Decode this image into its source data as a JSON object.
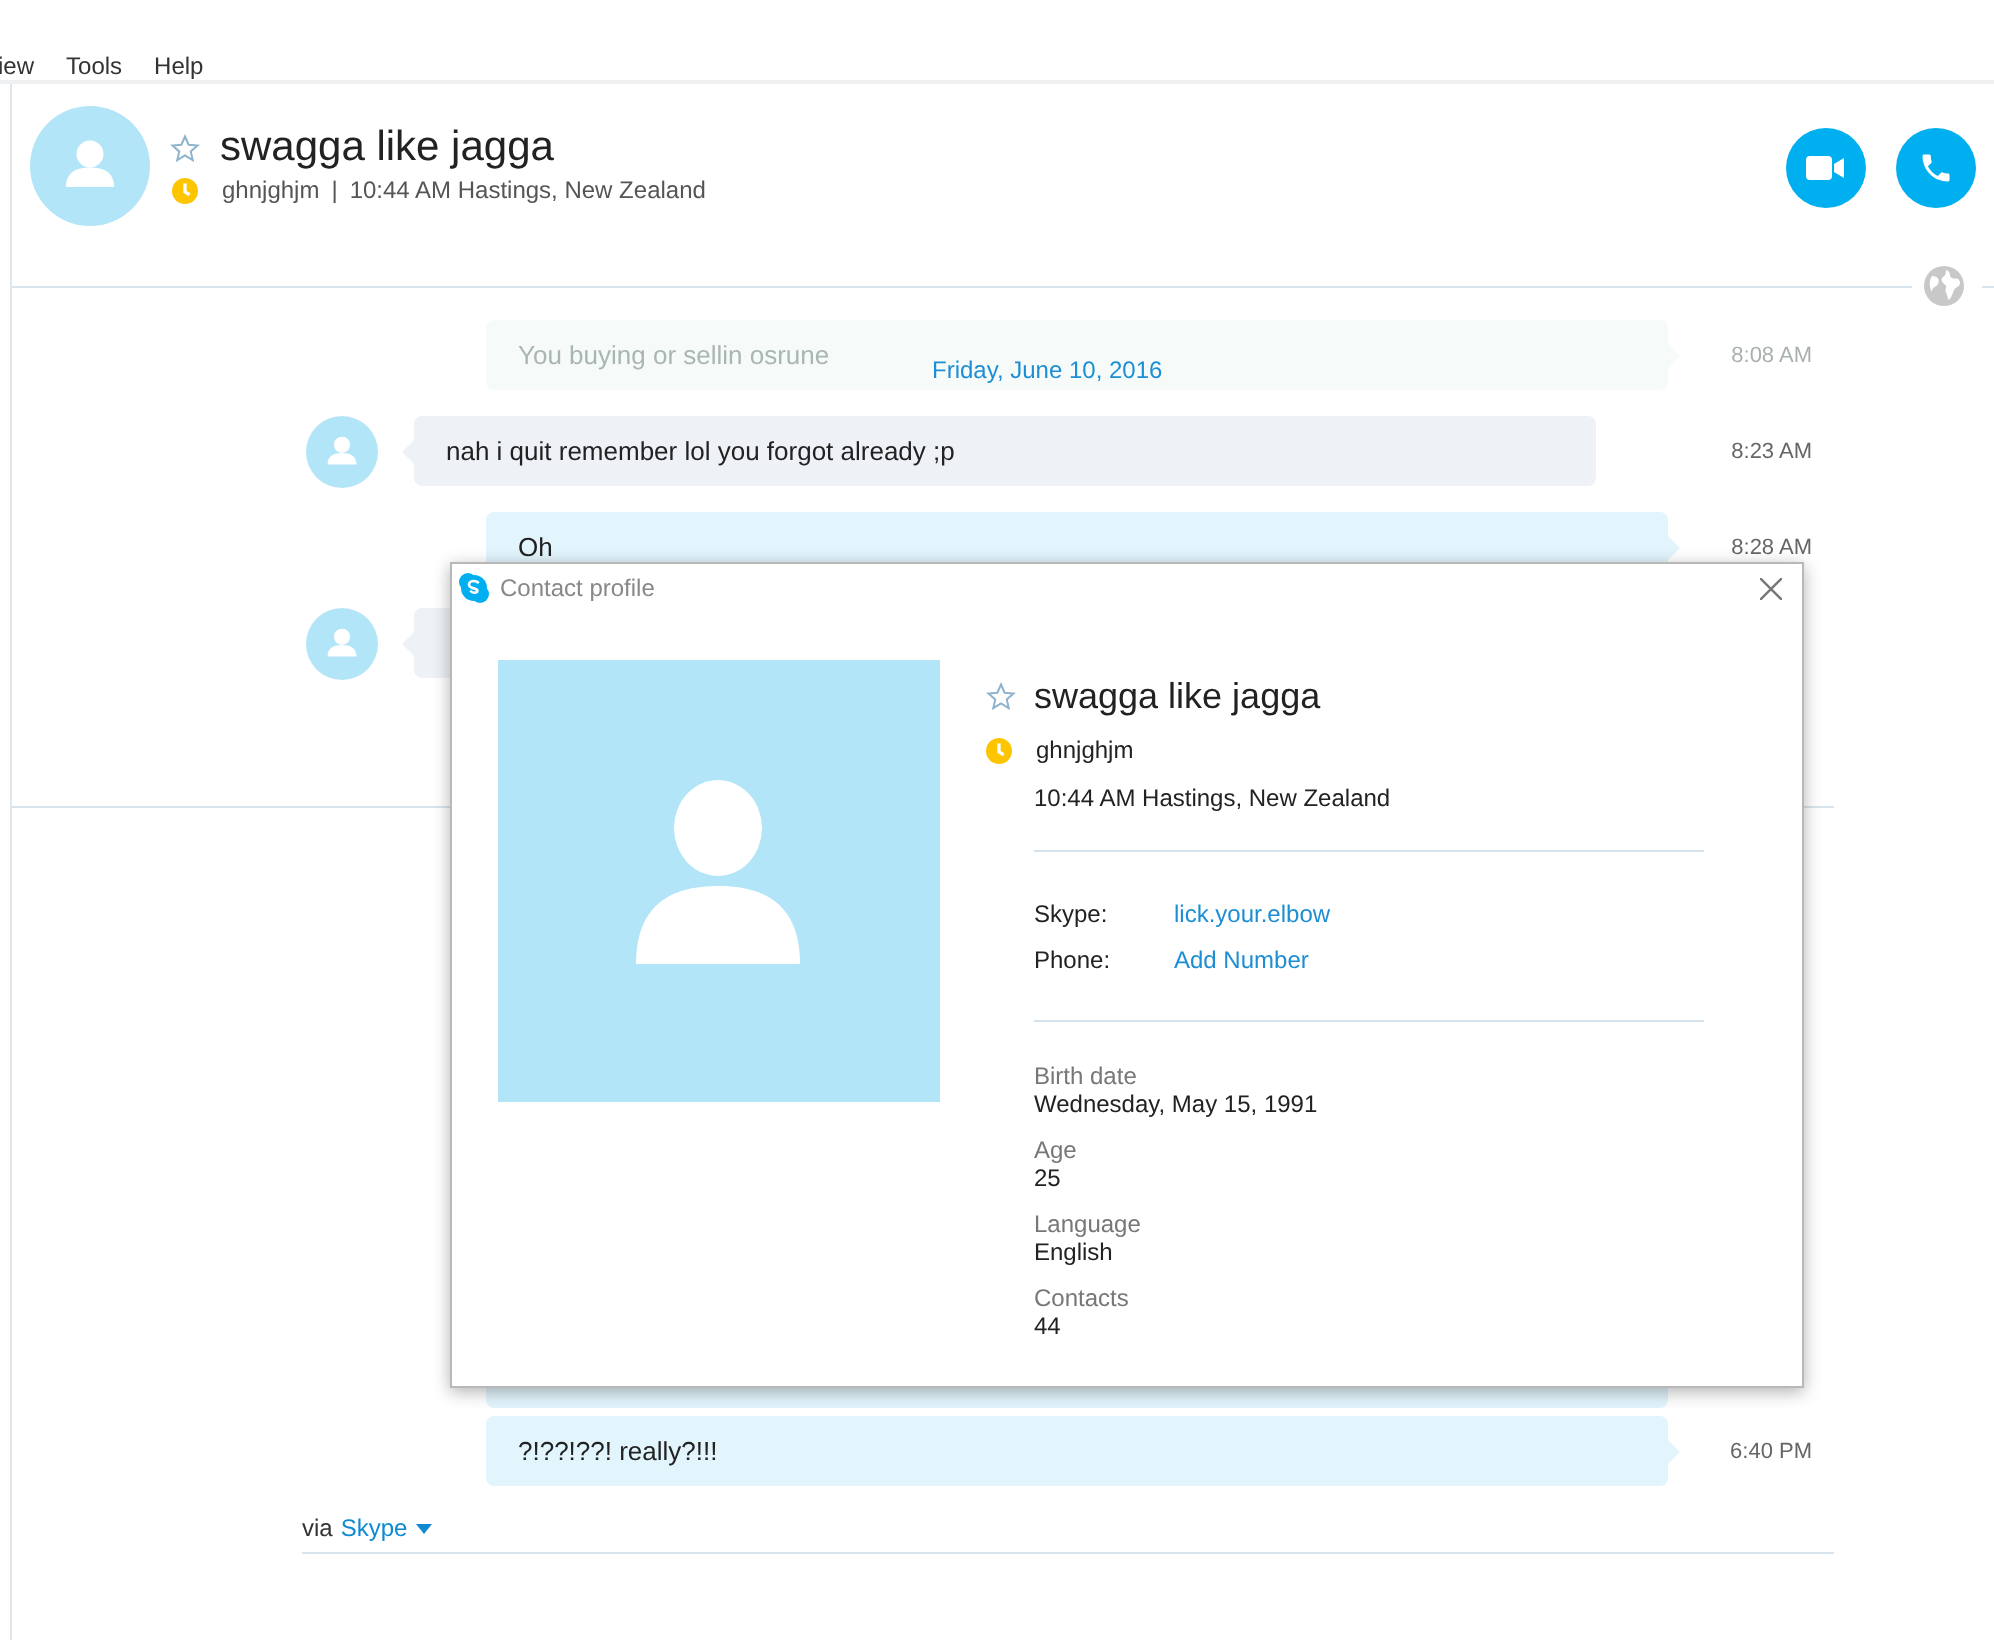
{
  "menu": [
    {
      "label": "iew"
    },
    {
      "label": "Tools"
    },
    {
      "label": "Help"
    }
  ],
  "header": {
    "name": "swagga like jagga",
    "favorite": false,
    "away": true,
    "mood": "ghnjghjm",
    "separator": "|",
    "local_time": "10:44 AM Hastings, New Zealand"
  },
  "date_separator": "Friday, June 10, 2016",
  "messages": [
    {
      "outgoing": true,
      "faded": true,
      "text": "You buying or sellin osrune",
      "time": "8:08 AM"
    },
    {
      "outgoing": false,
      "faded": false,
      "text": "nah i quit remember lol you forgot already ;p",
      "time": "8:23 AM"
    },
    {
      "outgoing": true,
      "faded": false,
      "text": "Oh",
      "time": "8:28 AM"
    },
    {
      "outgoing": false
    },
    {
      "outgoing": true
    },
    {
      "outgoing": true,
      "faded": false,
      "text": "?!??!??! really?!!!",
      "time": "6:40 PM"
    }
  ],
  "compose": {
    "via": "via",
    "service": "Skype"
  },
  "dialog": {
    "title": "Contact profile",
    "name": "swagga like jagga",
    "favorite": false,
    "away": true,
    "mood": "ghnjghjm",
    "local_time": "10:44 AM Hastings, New Zealand",
    "contacts": [
      {
        "label": "Skype:",
        "value": "lick.your.elbow"
      },
      {
        "label": "Phone:",
        "value": "Add Number"
      }
    ],
    "details": [
      {
        "label": "Birth date",
        "value": "Wednesday, May 15, 1991"
      },
      {
        "label": "Age",
        "value": "25"
      },
      {
        "label": "Language",
        "value": "English"
      },
      {
        "label": "Contacts",
        "value": "44"
      }
    ]
  }
}
